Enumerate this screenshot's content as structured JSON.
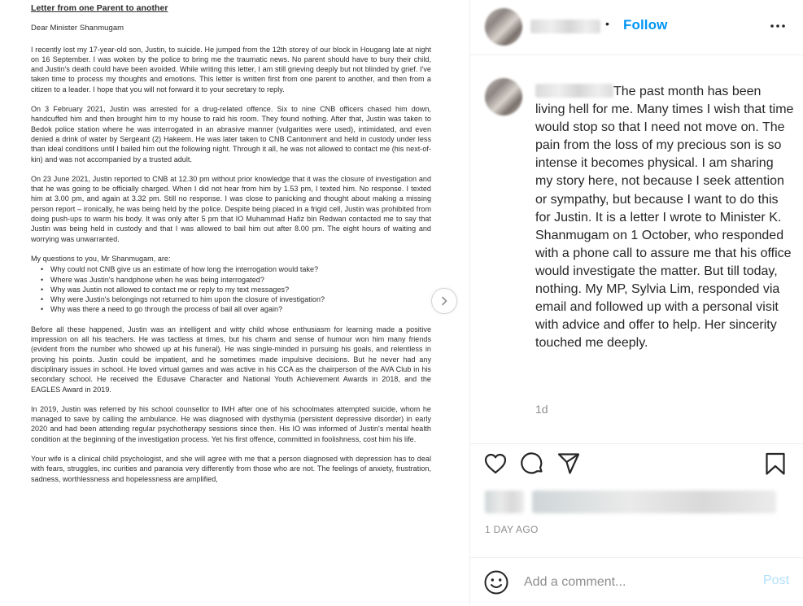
{
  "letter": {
    "title": "Letter from one Parent to another",
    "greeting": "Dear Minister Shanmugam",
    "paragraphs": [
      "I recently lost my 17-year-old son, Justin, to suicide. He jumped from the 12th storey of our block in Hougang late at night on 16 September. I was woken by the police to bring me the traumatic news. No parent should have to bury their child, and Justin's death could have been avoided. While writing this letter, I am still grieving deeply but not blinded by grief. I've taken time to process my thoughts and emotions. This letter is written first from one parent to another, and then from a citizen to a leader. I hope that you will not forward it to your secretary to reply.",
      "On 3 February 2021, Justin was arrested for a drug-related offence. Six to nine CNB officers chased him down, handcuffed him and then brought him to my house to raid his room. They found nothing. After that, Justin was taken to Bedok police station where he was interrogated in an abrasive manner (vulgarities were used), intimidated, and even denied a drink of water by Sergeant (2) Hakeem. He was later taken to CNB Cantonment and held in custody under less than ideal conditions until I bailed him out the following night. Through it all, he was not allowed to contact me (his next-of-kin) and was not accompanied by a trusted adult.",
      "On 23 June 2021, Justin reported to CNB at 12.30 pm without prior knowledge that it was the closure of investigation and that he was going to be officially charged. When I did not hear from him by 1.53 pm, I texted him. No response. I texted him at 3.00 pm, and again at 3.32 pm. Still no response. I was close to panicking and thought about making a missing person report – ironically, he was being held by the police. Despite being placed in a frigid cell, Justin was prohibited from doing push-ups to warm his body. It was only after 5 pm that IO Muhammad Hafiz bin Redwan contacted me to say that Justin was being held in custody and that I was allowed to bail him out after 8.00 pm. The eight hours of waiting and worrying was unwarranted."
    ],
    "questions_intro": "My questions to you, Mr Shanmugam, are:",
    "questions": [
      "Why could not CNB give us an estimate of how long the interrogation would take?",
      "Where was Justin's handphone when he was being interrogated?",
      "Why was Justin not allowed to contact me or reply to my text messages?",
      "Why were Justin's belongings not returned to him upon the closure of investigation?",
      "Why was there a need to go through the process of bail all over again?"
    ],
    "paragraphs_after": [
      "Before all these happened, Justin was an intelligent and witty child whose enthusiasm for learning made a positive impression on all his teachers. He was tactless at times, but his charm and sense of humour won him many friends (evident from the number who showed up at his funeral). He was single-minded in pursuing his goals, and relentless in proving his points. Justin could be impatient, and he sometimes made impulsive decisions. But he never had any disciplinary issues in school. He loved virtual games and was active in his CCA as the chairperson of the AVA Club in his secondary school. He received the Edusave Character and National Youth Achievement Awards in 2018, and the EAGLES Award in 2019.",
      "In 2019, Justin was referred by his school counsellor to IMH after one of his schoolmates attempted suicide, whom he managed to save by calling the ambulance. He was diagnosed with dysthymia (persistent depressive disorder) in early 2020 and had been attending regular psychotherapy sessions since then. His IO was informed of Justin's mental health condition at the beginning of the investigation process. Yet his first offence, committed in foolishness, cost him his life.",
      "Your wife is a clinical child psychologist, and she will agree with me that a person diagnosed with depression has to deal with fears, struggles, inc curities and paranoia very differently from those who are not. The feelings of anxiety, frustration, sadness, worthlessness and hopelessness are amplified,"
    ]
  },
  "header": {
    "separator": "•",
    "follow_label": "Follow",
    "more_icon": "more-options-icon"
  },
  "comment": {
    "caption": "The past month has been living hell for me. Many times I wish that time would stop so that I need not move on. The pain from the loss of my precious son is so intense it becomes physical. I am sharing my story here, not because I seek attention or sympathy, but because I want to do this for Justin. It is a letter I wrote to Minister K. Shanmugam on 1 October, who responded with a phone call to assure me that his office would investigate the matter. But till today, nothing. My MP, Sylvia Lim, responded via email and followed up with a personal visit with advice and offer to help. Her sincerity touched me deeply.",
    "age": "1d"
  },
  "actions": {
    "like_icon": "heart-icon",
    "comment_icon": "comment-bubble-icon",
    "share_icon": "paper-plane-icon",
    "save_icon": "bookmark-icon"
  },
  "post_date": "1 DAY AGO",
  "add_comment": {
    "placeholder": "Add a comment...",
    "post_label": "Post",
    "emoji_icon": "smiley-icon"
  },
  "colors": {
    "link_blue": "#0095f6",
    "post_disabled": "#b2dffc",
    "secondary_text": "#8e8e8e",
    "border": "#efefef"
  }
}
